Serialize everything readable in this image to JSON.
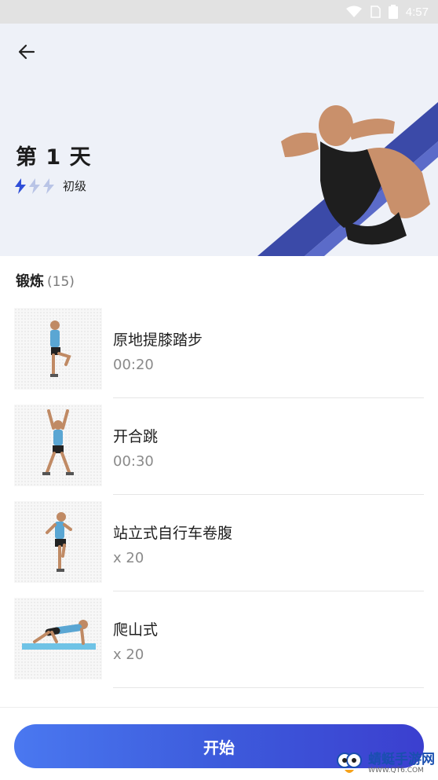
{
  "status_bar": {
    "time": "4:57"
  },
  "header": {
    "day_title": "第 1 天",
    "level_label": "初级",
    "level": {
      "filled": 1,
      "total": 3
    }
  },
  "section": {
    "title": "锻炼",
    "count": "(15)"
  },
  "exercises": [
    {
      "name": "原地提膝踏步",
      "meta": "00:20"
    },
    {
      "name": "开合跳",
      "meta": "00:30"
    },
    {
      "name": "站立式自行车卷腹",
      "meta": "x 20"
    },
    {
      "name": "爬山式",
      "meta": "x 20"
    }
  ],
  "start_button": {
    "label": "开始"
  },
  "watermark": {
    "title": "蜻蜓手游网",
    "url": "WWW.QT6.COM"
  },
  "colors": {
    "accent": "#3d5bdc",
    "hero_bg": "#eef1f8",
    "level_active": "#2f4fd8",
    "level_inactive": "#b9c4e6"
  }
}
